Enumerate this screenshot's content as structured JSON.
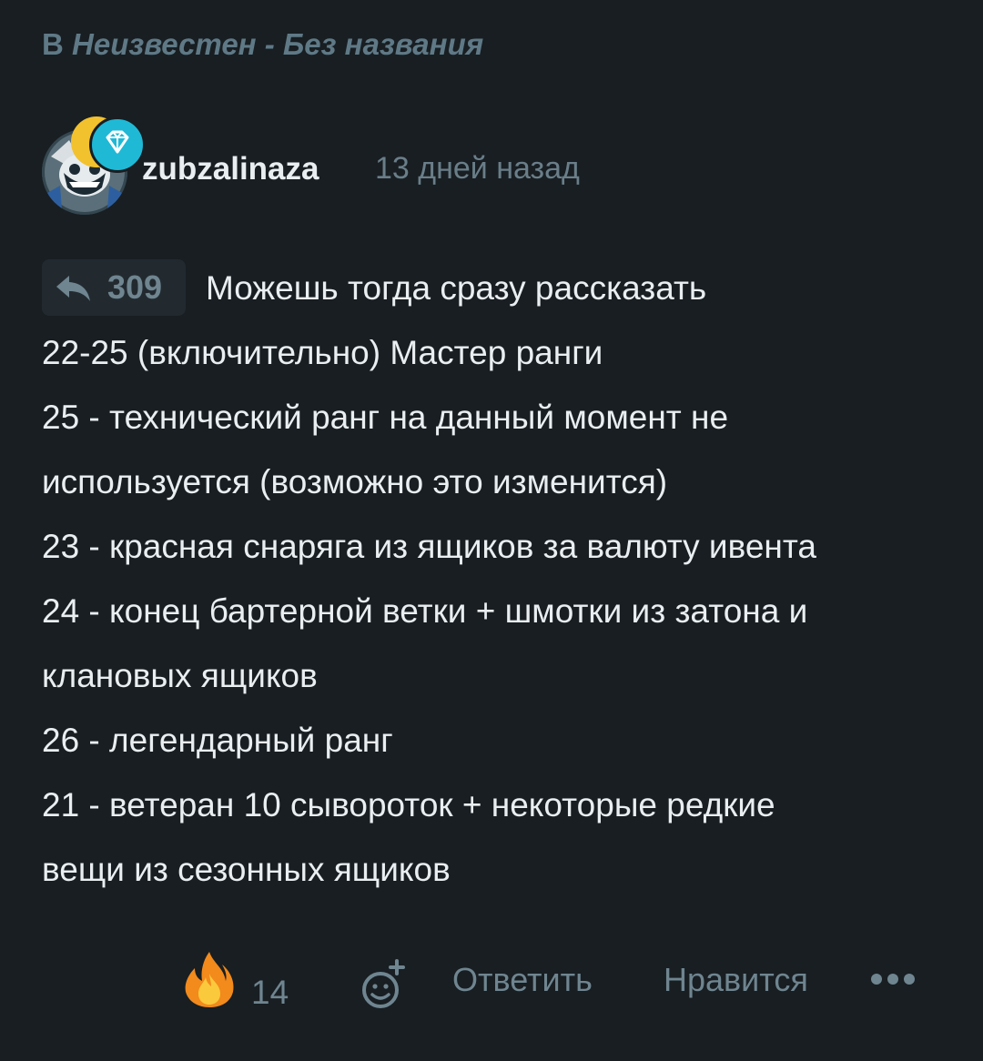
{
  "context": {
    "prefix": "В",
    "title": "Неизвестен - Без названия"
  },
  "comment": {
    "author": "zubzalinaza",
    "time": "13 дней назад",
    "reply_to_count": "309",
    "lines": [
      "Можешь тогда сразу рассказать",
      "22-25 (включительно) Мастер ранги",
      "25 - технический ранг на данный момент не",
      "используется (возможно это изменится)",
      "23 - красная снаряга из ящиков за валюту ивента",
      "24 - конец бартерной ветки + шмотки из затона и",
      "клановых ящиков",
      "26 - легендарный ранг",
      "21 - ветеран 10 сывороток + некоторые редкие",
      "вещи из сезонных ящиков"
    ]
  },
  "actions": {
    "reaction_count": "14",
    "reply_label": "Ответить",
    "like_label": "Нравится"
  },
  "icons": {
    "reply_chip": "reply-arrow-icon",
    "reaction": "fire-icon",
    "add_reaction": "add-emoji-icon",
    "badge": "diamond-icon",
    "more": "more-dots-icon"
  },
  "colors": {
    "background": "#181e22",
    "text": "#e9eef1",
    "muted": "#6f8590",
    "context": "#5f7986",
    "diamond_badge": "#1fb9d6",
    "gold_badge": "#f2c12e"
  }
}
